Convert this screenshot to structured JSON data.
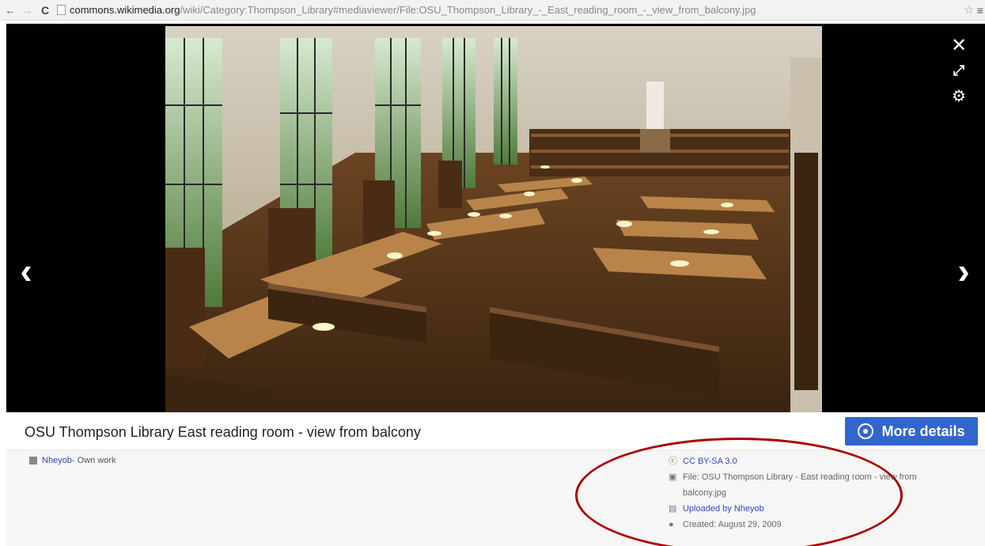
{
  "browser": {
    "back_icon": "back-arrow-icon",
    "forward_icon": "forward-arrow-icon",
    "reload_icon": "reload-icon",
    "url_host": "commons.wikimedia.org",
    "url_path": "/wiki/Category:Thompson_Library#mediaviewer/File:OSU_Thompson_Library_-_East_reading_room_-_view_from_balcony.jpg",
    "glyphs": {
      "back": "←",
      "forward": "→",
      "reload": "C",
      "star": "☆",
      "menu": "≡"
    }
  },
  "viewer": {
    "controls": {
      "close": "✕",
      "fullscreen": "⤢",
      "settings": "⚙",
      "prev": "‹",
      "next": "›"
    },
    "image_subject": "library reading room photograph"
  },
  "file": {
    "title": "OSU Thompson Library East reading room - view from balcony",
    "more_details_label": "More details"
  },
  "metadata": {
    "author_link": "Nheyob",
    "author_suffix": " - Own work",
    "license": "CC BY-SA 3.0",
    "file_line": "File: OSU Thompson Library - East reading room - view from balcony.jpg",
    "uploaded_by": "Uploaded by Nheyob",
    "created": "Created: August 29, 2009"
  },
  "colors": {
    "accent": "#3366cc",
    "annotation": "#aa0000",
    "link": "#3645c4"
  }
}
